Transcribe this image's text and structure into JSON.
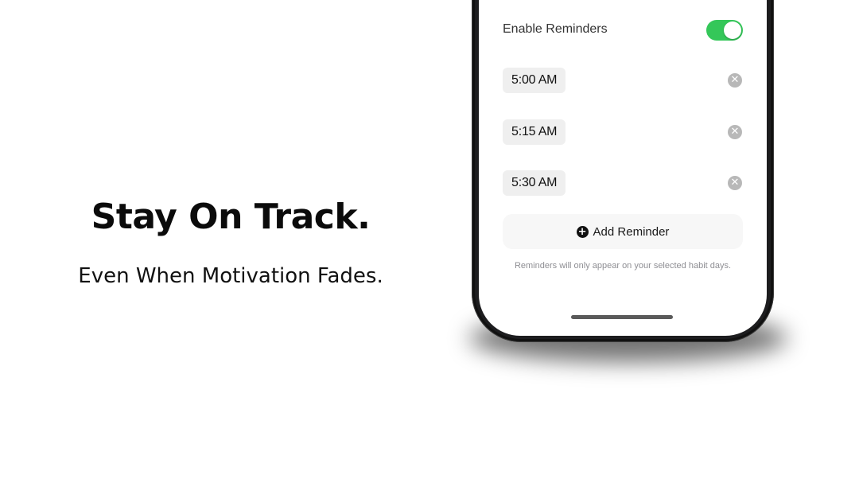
{
  "marketing": {
    "headline": "Stay On Track.",
    "subhead": "Even When Motivation Fades."
  },
  "settings": {
    "enable_label": "Enable Reminders",
    "enabled": true,
    "toggle_color": "#34c759"
  },
  "reminders": [
    {
      "time": "5:00 AM",
      "remove_icon": "close-circle-icon"
    },
    {
      "time": "5:15 AM",
      "remove_icon": "close-circle-icon"
    },
    {
      "time": "5:30 AM",
      "remove_icon": "close-circle-icon"
    }
  ],
  "add_button": {
    "label": "Add Reminder",
    "icon": "plus-circle-icon"
  },
  "footnote": "Reminders will only appear on your selected habit days."
}
